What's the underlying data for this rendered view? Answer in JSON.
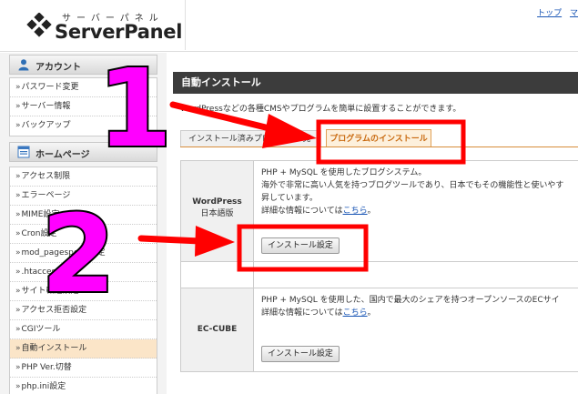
{
  "header": {
    "logo_sub": "サーバーパネル",
    "logo_main": "ServerPanel",
    "links": [
      "トップ",
      "マ"
    ]
  },
  "sidebar": {
    "sections": [
      {
        "title": "アカウント",
        "icon": "user-icon",
        "items": [
          "パスワード変更",
          "サーバー情報",
          "バックアップ"
        ]
      },
      {
        "title": "ホームページ",
        "icon": "homepage-icon",
        "items": [
          "アクセス制限",
          "エラーページ",
          "MIME設定",
          "Cron設定",
          "mod_pagespeed設定",
          ".htaccess編集",
          "サイト転送設定",
          "アクセス拒否設定",
          "CGIツール",
          "自動インストール",
          "PHP Ver.切替",
          "php.ini設定"
        ]
      }
    ],
    "active_item": "自動インストール"
  },
  "main": {
    "title": "自動インストール",
    "description": "WordPressなどの各種CMSやプログラムを簡単に設置することができます。",
    "tabs": [
      "インストール済みプログラム一覧",
      "プログラムのインストール"
    ],
    "programs": [
      {
        "name_line1": "WordPress",
        "name_line2": "日本語版",
        "lines": [
          "PHP + MySQL を使用したブログシステム。",
          "海外で非常に高い人気を持つブログツールであり、日本でもその機能性と使いやす",
          "昇しています。"
        ],
        "detail_text": "詳細な情報については",
        "detail_link": "こちら",
        "detail_suffix": "。",
        "button": "インストール設定"
      },
      {
        "name_line1": "EC-CUBE",
        "lines": [
          "PHP + MySQL を使用した、国内で最大のシェアを持つオープンソースのECサイ"
        ],
        "detail_text": "詳細な情報については",
        "detail_link": "こちら",
        "detail_suffix": "。",
        "button": "インストール設定"
      }
    ]
  },
  "annotations": {
    "step1": "1",
    "step2": "2",
    "highlight_color": "#ff0000",
    "number_color": "#ff00ff"
  },
  "colors": {
    "title_bar": "#3c3c3c",
    "active_tab_text": "#c96a10",
    "active_sidebar": "#fbe5c8",
    "link": "#1a56b5"
  }
}
